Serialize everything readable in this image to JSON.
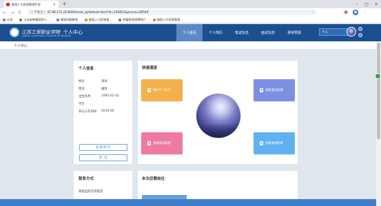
{
  "browser": {
    "tab_title": "衡稻人力资源管理平台",
    "tab_close": "×",
    "new_tab": "+",
    "window_controls": [
      "–",
      "□",
      "×"
    ],
    "nav": {
      "back": "←",
      "forward": "→",
      "reload": "C"
    },
    "security_label": "ⓘ 不安全 |",
    "url": "47.98.174.22:8094/main_kj/default.html?id=105853&provid=99549",
    "star": "☆",
    "bookmarks": [
      {
        "label": "应用",
        "icon": "apps-icon"
      },
      {
        "label": "江苏省肿瘤医院人...",
        "icon": "bookmark-icon"
      },
      {
        "label": "微软同勤教育",
        "icon": "bookmark-icon"
      },
      {
        "label": "衡稻人力资源管...",
        "icon": "bookmark-icon"
      },
      {
        "label": "肿瘤医院招聘简介",
        "icon": "bookmark-icon"
      },
      {
        "label": "衡稻人力资源管理...",
        "icon": "bookmark-icon"
      }
    ]
  },
  "header": {
    "logo_title": "江苏工贸职业学院",
    "logo_subtitle": "个人中心",
    "logo_english": "JIANGSU VOCATIONAL COLLEGE OF INDUSTRY",
    "nav_items": [
      {
        "label": "个人首页",
        "active": true
      },
      {
        "label": "个人简历",
        "active": false
      },
      {
        "label": "笔试信息",
        "active": false
      },
      {
        "label": "面试信息",
        "active": false
      },
      {
        "label": "录用预报",
        "active": false
      }
    ],
    "user_select": {
      "value": "个人",
      "arrow": "▾"
    }
  },
  "breadcrumb": "个人中心",
  "personal_info": {
    "title": "个人信息",
    "rows": [
      {
        "label": "姓名",
        "value": "测试"
      },
      {
        "label": "性别",
        "value": "通性"
      },
      {
        "label": "出生年月",
        "value": "1995-02-26"
      },
      {
        "label": "学历",
        "value": ""
      },
      {
        "label": "参与工作时间",
        "value": "2019-06"
      }
    ],
    "view_resume_button": "查看简历",
    "logout_button": "退 出"
  },
  "quick_access": {
    "title": "快速通道",
    "cards": [
      {
        "label": "维护个人简历",
        "color": "#f4b04a"
      },
      {
        "label": "查看面试成绩",
        "color": "#7b8fe3"
      },
      {
        "label": "查看笔试成绩",
        "color": "#ef7aa0"
      },
      {
        "label": "查看录用结果",
        "color": "#5fb2f0"
      }
    ]
  },
  "contact": {
    "title": "联系方式",
    "line": "系统出库咨询电话"
  },
  "recruitment": {
    "title": "本次应聘岗位"
  },
  "colors": {
    "header_bg": "#1b4f8f",
    "nav_active": "#5d88c5",
    "page_bg": "#dfe6ee"
  }
}
